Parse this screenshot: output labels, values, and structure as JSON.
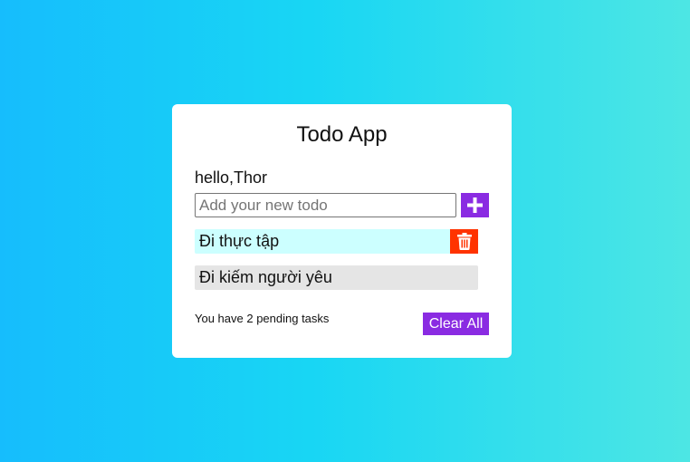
{
  "app": {
    "title": "Todo App",
    "greeting": "hello,Thor"
  },
  "input": {
    "placeholder": "Add your new todo",
    "value": ""
  },
  "add_button": {
    "icon": "plus-icon"
  },
  "todos": [
    {
      "text": "Đi thực tập",
      "highlighted": true
    },
    {
      "text": "Đi kiếm người yêu",
      "highlighted": false
    }
  ],
  "delete_button": {
    "icon": "trash-icon"
  },
  "footer": {
    "pending_text": "You have 2 pending tasks",
    "clear_label": "Clear All"
  },
  "colors": {
    "accent": "#8a2be2",
    "danger": "#ff3300",
    "highlight": "#ccffff",
    "item_bg": "#e5e5e5",
    "background_start": "#16bdfd",
    "background_end": "#4de6e4"
  }
}
